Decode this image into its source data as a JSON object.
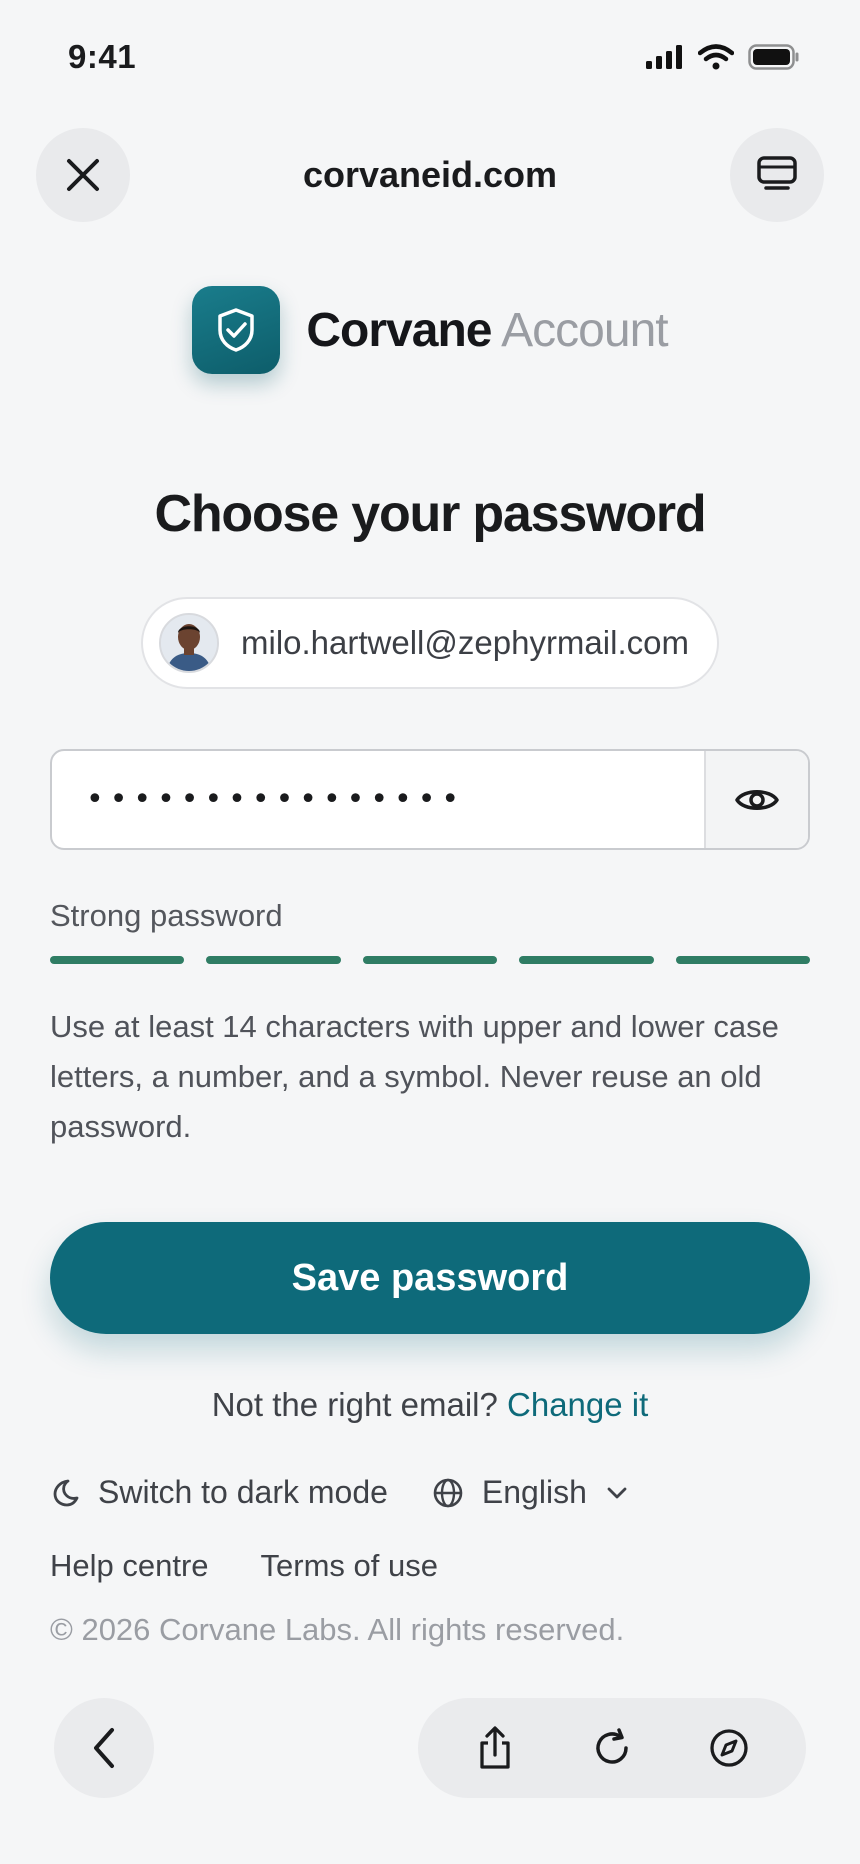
{
  "status_bar": {
    "time": "9:41",
    "icons": [
      "cellular-signal-icon",
      "wifi-icon",
      "battery-icon"
    ]
  },
  "browser": {
    "url": "corvaneid.com",
    "close_icon": "close-icon",
    "tabs_icon": "tabs-icon"
  },
  "brand": {
    "name": "Corvane",
    "suffix": "Account",
    "logo_icon": "shield-check-icon",
    "accent_color": "#0e6a7a"
  },
  "page": {
    "title": "Choose your password"
  },
  "account": {
    "email": "milo.hartwell@zephyrmail.com"
  },
  "password_field": {
    "value": "••••••••••••••••",
    "toggle_icon": "eye-icon"
  },
  "strength": {
    "label": "Strong password",
    "filled_segments": 5,
    "total_segments": 5,
    "color": "#2f7d64"
  },
  "hint": "Use at least 14 characters with upper and lower case letters, a number, and a symbol. Never reuse an old password.",
  "save_button": "Save password",
  "change_email": {
    "prompt": "Not the right email?",
    "link": "Change it"
  },
  "footer": {
    "dark_mode": "Switch to dark mode",
    "language": "English",
    "help": "Help centre",
    "terms": "Terms of use",
    "copyright": "© 2026 Corvane Labs. All rights reserved."
  },
  "bottom_toolbar": {
    "icons": [
      "back-icon",
      "share-icon",
      "reload-icon",
      "compass-icon"
    ]
  }
}
